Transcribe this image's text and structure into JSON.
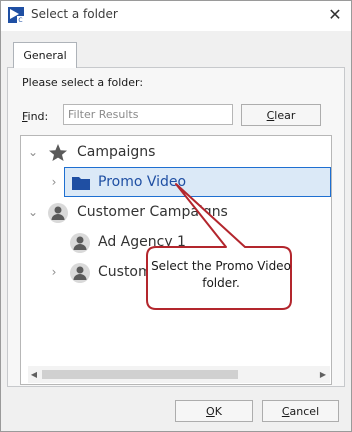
{
  "window": {
    "title": "Select a folder"
  },
  "tabs": [
    {
      "label": "General"
    }
  ],
  "prompt": "Please select a folder:",
  "find": {
    "label_first": "F",
    "label_rest": "ind:",
    "placeholder": "Filter Results"
  },
  "clear_button": {
    "first": "C",
    "rest": "lear"
  },
  "tree": {
    "nodes": [
      {
        "label": "Campaigns",
        "icon": "star-icon",
        "expanded": true
      },
      {
        "label": "Promo Video",
        "icon": "folder-icon",
        "selected": true
      },
      {
        "label": "Customer Campaigns",
        "icon": "people-icon",
        "expanded": true
      },
      {
        "label": "Ad Agency 1",
        "icon": "people-icon"
      },
      {
        "label": "Custom",
        "icon": "people-icon"
      }
    ]
  },
  "callout": {
    "line1": "Select the Promo Video",
    "line2": "folder."
  },
  "buttons": {
    "ok": {
      "first": "O",
      "rest": "K"
    },
    "cancel": {
      "first": "C",
      "rest": "ancel"
    }
  },
  "colors": {
    "selected_border": "#1e6fd1",
    "selected_bg": "#dbe9f7",
    "callout_red": "#b3262d",
    "folder_blue": "#1f4fa3"
  }
}
